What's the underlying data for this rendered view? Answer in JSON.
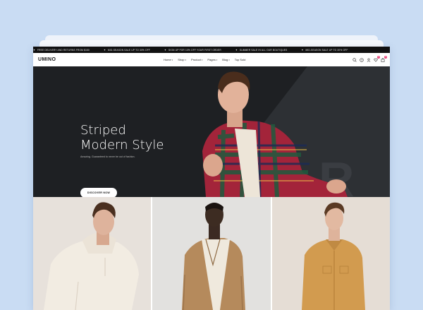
{
  "ticker": [
    "FREE DELIVERY AND RETURNS FROM $150",
    "MID-SEASON SALE UP TO 30% OFF",
    "SIGN UP FOR 10% OFF YOUR FIRST ORDER",
    "SUMMER SALE IN ALL OUR BOUTIQUES",
    "MID-SEASON SALE UP TO 30% OFF"
  ],
  "brand": {
    "logo": "UMINO"
  },
  "nav": {
    "home": "Home",
    "shop": "Shop",
    "product": "Product",
    "pages": "Pages",
    "blog": "Blog",
    "top_sold": "Top Sold"
  },
  "header_icons": {
    "cart_count": "0",
    "wishlist_count": "0"
  },
  "hero": {
    "title_line1": "Striped",
    "title_line2": "Modern Style",
    "subtitle": "Amazing. Guaranteed to never be out of fashion.",
    "cta": "DISCOVER NOW"
  },
  "colors": {
    "background": "#c9dcf3",
    "hero_bg": "#1e2023",
    "accent": "#e8457a"
  }
}
